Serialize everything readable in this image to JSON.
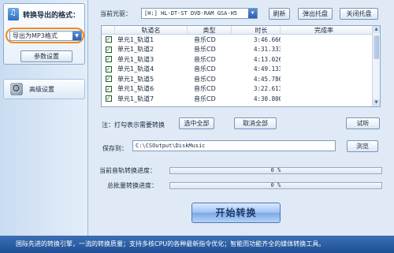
{
  "left_panel": {
    "format_title": "转换导出的格式：",
    "format_select_value": "导出为MP3格式",
    "param_button": "参数设置",
    "advanced_label": "高级设置"
  },
  "drive": {
    "label": "当前光驱：",
    "value": "[H:] HL-DT-ST DVD-RAM GSA-H5",
    "refresh": "刷新",
    "eject": "弹出托盘",
    "close": "关闭托盘"
  },
  "table": {
    "headers": [
      "轨道名",
      "类型",
      "时长",
      "完成率"
    ],
    "rows": [
      {
        "name": "单元1_轨道1",
        "type": "音乐CD",
        "duration": "3:46.666",
        "done": ""
      },
      {
        "name": "单元1_轨道2",
        "type": "音乐CD",
        "duration": "4:31.333",
        "done": ""
      },
      {
        "name": "单元1_轨道3",
        "type": "音乐CD",
        "duration": "4:13.026",
        "done": ""
      },
      {
        "name": "单元1_轨道4",
        "type": "音乐CD",
        "duration": "4:49.133",
        "done": ""
      },
      {
        "name": "单元1_轨道5",
        "type": "音乐CD",
        "duration": "4:45.786",
        "done": ""
      },
      {
        "name": "单元1_轨道6",
        "type": "音乐CD",
        "duration": "3:22.613",
        "done": ""
      },
      {
        "name": "单元1_轨道7",
        "type": "音乐CD",
        "duration": "4:30.800",
        "done": ""
      }
    ],
    "check_mark": "✓"
  },
  "controls": {
    "note": "注：打勾表示需要转换",
    "select_all": "选中全部",
    "deselect_all": "取消全部",
    "preview": "试听"
  },
  "save": {
    "label": "保存到：",
    "path": "C:\\CSOutput\\DiskMusic",
    "browse": "浏览"
  },
  "progress": {
    "current_label": "当前音轨转换进度：",
    "current_value": "0 %",
    "current_fraction": 0,
    "total_label": "总批量转换进度：",
    "total_value": "0 %",
    "total_fraction": 0
  },
  "start_button": "开始转换",
  "footer": "国际先进的转换引擎，一流的转换质量；支持多核CPU的各种最新指令优化；智能而功能齐全的媒体转换工具。",
  "colors": {
    "accent_orange": "#f08a1c",
    "footer_blue": "#2a5fa5"
  }
}
